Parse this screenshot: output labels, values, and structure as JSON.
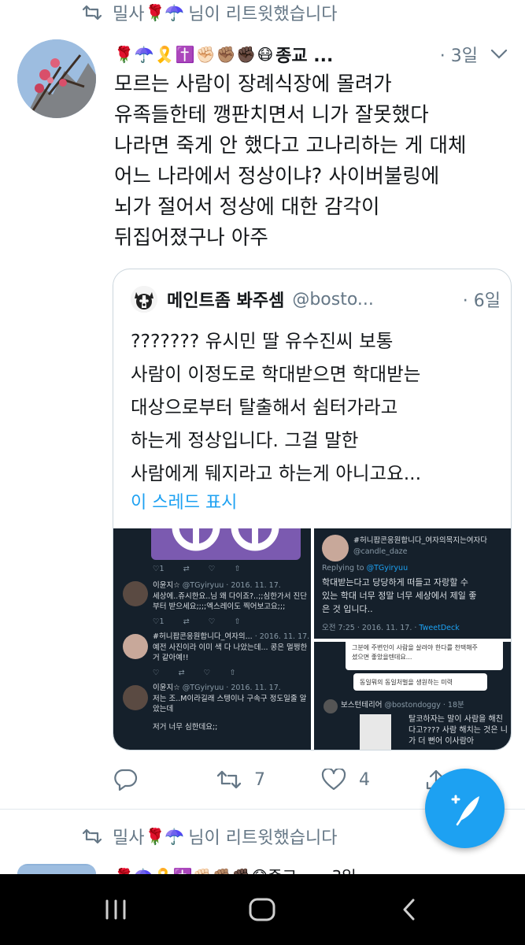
{
  "retweet_context": {
    "user": "밀사",
    "emojis": "🌹☂️",
    "action_text": "님이 리트윗했습니다"
  },
  "tweet": {
    "name_emojis": "🌹☂️🎗️✝️✊🏻✊🏽✊🏿😷",
    "display_name": "종교 ...",
    "time": "· 3일",
    "text_lines": [
      "모르는 사람이 장례식장에 몰려가",
      "유족들한테 깽판치면서 니가 잘못했다",
      "나라면 죽게 안 했다고 고나리하는 게 대체",
      "어느 나라에서 정상이냐? 사이버불링에",
      "뇌가 절어서 정상에 대한 감각이",
      "뒤집어졌구나 아주"
    ],
    "counts": {
      "replies": "",
      "retweets": "7",
      "likes": "4"
    }
  },
  "quote": {
    "display_name": "메인트좀 봐주셈",
    "handle": "@bosto...",
    "time": "· 6일",
    "text_lines": [
      "??????? 유시민 딸 유수진씨 보통",
      "사람이 이정도로 학대받으면 학대받는",
      "대상으로부터 탈출해서 쉼터가라고",
      "하는게 정상입니다. 그걸 말한",
      "사람에게 뒈지라고 하는게 아니고요..."
    ],
    "thread_link": "이 스레드 표시",
    "media": {
      "tile_a": {
        "line1_name": "이윤지☆",
        "line1_meta": "@TGyiryuu · 2016. 11. 17.",
        "line1_text1": "세상에..쥬시한요..님 왜 다이죠?..;;심한가서 진단",
        "line1_text2": "부터 받으세요;;;;엑스레이도 찍어보고요;;;",
        "line2_name": "#허니팝콘응원합니다_여자의...",
        "line2_meta": "· 2016. 11. 17.",
        "line2_text1": "예전 사진이라 이미 색 다 나았는데... 콩은 멀쩡한",
        "line2_text2": "거 같아예!!",
        "line3_name": "이윤지☆",
        "line3_meta": "@TGyiryuu · 2016. 11. 17.",
        "line3_text1": "저는 조..M이라길래 스텡이나 구속구 정도일줄 알",
        "line3_text2": "았는데",
        "line3_text3": "저거 너무 심한데요;;"
      },
      "tile_b": {
        "name": "#허니팝콘응원합니다_여자의목지는여자다",
        "handle": "@candle_daze",
        "replying": "Replying to",
        "replying_to": "@TGyiryuu",
        "body1": "학대받는다고 당당하게 떠들고 자랑할 수",
        "body2": "있는 학대 너무 정말 너무 세상에서 제일 좋",
        "body3": "은 것 입니다..",
        "footer": "오전 7:25 · 2016. 11. 17. ·",
        "footer_app": "TweetDeck"
      },
      "tile_c": {
        "top1": "그분에 주변인이 사람을 살려야 한다를 천택해주",
        "top2": "셨으면 좋았을텐데요...",
        "bubble": "동일뭐의 동일처벌을 생원하는 미력",
        "name": "보스턴테리어",
        "handle": "@bostondoggy · 18분",
        "body1": "탈코하자는 말이 사람을 해친",
        "body2": "다고???? 사람 해치는 것은 니",
        "body3": "가 더 뻔어 이사람아"
      }
    }
  },
  "next_retweet": {
    "user": "밀사",
    "emojis": "🌹☂️",
    "action_text": "님이 리트윗했습니다",
    "partial_header": "🌹☂️🎗️✝️✊🏻✊🏽✊🏿😷종교 ... · 3일"
  },
  "colors": {
    "accent": "#1da1f2",
    "muted": "#657786",
    "border": "#ccd6dd",
    "dark_tile": "#15202b",
    "nav_bar": "#000000"
  },
  "icons": {
    "retweet": "retweet-icon",
    "chevron": "chevron-down-icon",
    "reply": "reply-icon",
    "like": "heart-icon",
    "share": "share-icon",
    "compose": "compose-icon",
    "nav_recent": "recent-apps-icon",
    "nav_home": "home-icon",
    "nav_back": "back-icon"
  }
}
